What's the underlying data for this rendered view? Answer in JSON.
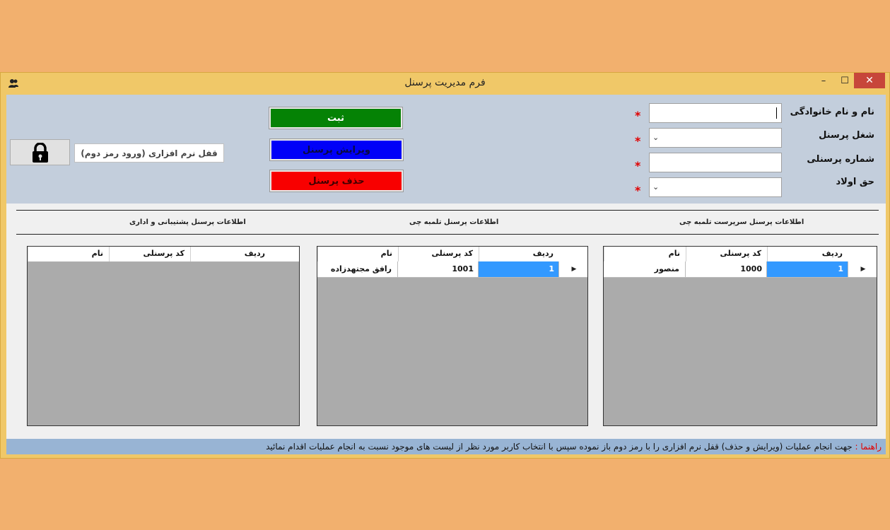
{
  "window": {
    "title": "فرم مدیریت پرسنل",
    "controls": {
      "minimize": "–",
      "maximize": "☐",
      "close": "✕"
    }
  },
  "form": {
    "fields": [
      {
        "label": "نام و نام خانوادگی",
        "value": "",
        "type": "text",
        "required": "*"
      },
      {
        "label": "شغل پرسنل",
        "value": "",
        "type": "combo",
        "required": "*"
      },
      {
        "label": "شماره پرسنلی",
        "value": "",
        "type": "text",
        "required": "*"
      },
      {
        "label": "حق اولاد",
        "value": "",
        "type": "combo",
        "required": "*"
      }
    ]
  },
  "actions": {
    "save": "ثبت",
    "edit": "ویرایش پرسنل",
    "delete": "حذف پرسنل"
  },
  "lock": {
    "label": "قفل نرم افزاری (ورود رمز دوم)",
    "icon": "lock-icon"
  },
  "sections": [
    {
      "title": "اطلاعات پرسنل سرپرست تلمبه چی",
      "columns": [
        "ردیف",
        "کد پرسنلی",
        "نام"
      ],
      "rows": [
        {
          "row": "1",
          "code": "1000",
          "name": "منصور"
        }
      ]
    },
    {
      "title": "اطلاعات پرسنل تلمبه چی",
      "columns": [
        "ردیف",
        "کد پرسنلی",
        "نام"
      ],
      "rows": [
        {
          "row": "1",
          "code": "1001",
          "name": "رافق مجتهدزاده"
        }
      ]
    },
    {
      "title": "اطلاعات پرسنل پشتیبانی و اداری",
      "columns": [
        "ردیف",
        "کد پرسنلی",
        "نام"
      ],
      "rows": []
    }
  ],
  "status": {
    "label": "راهنما :",
    "text": "جهت انجام عملیات (ویرایش و حذف) قفل نرم افزاری را با رمز دوم باز نموده سپس با انتخاب کاربر مورد نظر از لیست های موجود نسبت به انجام عملیات اقدام نمائید"
  },
  "colors": {
    "background": "#f2b06e",
    "save": "#058205",
    "edit": "#0000f8",
    "delete": "#f80000",
    "selection": "#3399ff",
    "status_bar": "#98b4d4"
  }
}
